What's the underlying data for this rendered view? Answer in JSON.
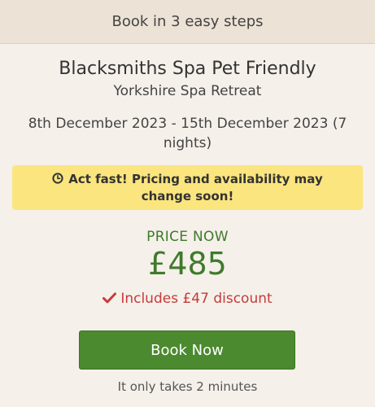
{
  "header": {
    "title": "Book in 3 easy steps"
  },
  "hotel": {
    "name": "Blacksmiths Spa Pet Friendly",
    "location": "Yorkshire Spa Retreat",
    "dates": "8th December 2023 - 15th December 2023 (7 nights)"
  },
  "alert": {
    "icon": "clock-icon",
    "text": "Act fast! Pricing and availability may change soon!",
    "background": "#fbe57f"
  },
  "price": {
    "label": "PRICE NOW",
    "amount": "£485",
    "discount_text": "Includes £47 discount",
    "discount_icon": "checkmark-icon",
    "color": "#3f7a2c",
    "discount_color": "#c63b3b"
  },
  "cta": {
    "label": "Book Now",
    "color": "#4b8a2f",
    "note": "It only takes 2 minutes"
  }
}
